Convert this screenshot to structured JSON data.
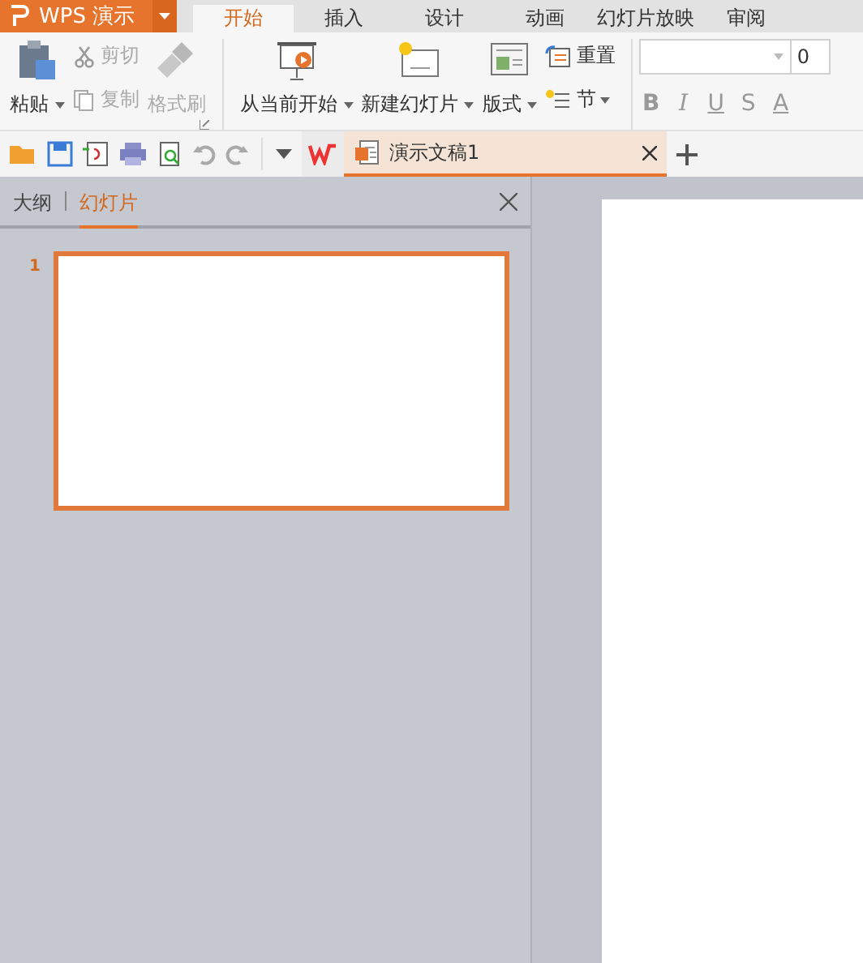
{
  "app_menu": {
    "label": "WPS 演示"
  },
  "tabs": [
    {
      "label": "开始",
      "selected": true
    },
    {
      "label": "插入",
      "selected": false
    },
    {
      "label": "设计",
      "selected": false
    },
    {
      "label": "动画",
      "selected": false
    },
    {
      "label": "幻灯片放映",
      "selected": false
    },
    {
      "label": "审阅",
      "selected": false
    }
  ],
  "clipboard": {
    "paste": "粘贴",
    "cut": {
      "label": "剪切",
      "disabled": true
    },
    "copy": {
      "label": "复制",
      "disabled": true
    },
    "format_painter": {
      "label": "格式刷",
      "disabled": true
    }
  },
  "slides_group": {
    "start": "从当前开始",
    "new_slide": "新建幻灯片",
    "layout": "版式",
    "reset": "重置",
    "section": "节"
  },
  "font": {
    "size": "0",
    "styles": [
      "B",
      "I",
      "U",
      "S",
      "A"
    ]
  },
  "document_tab": {
    "title": "演示文稿1"
  },
  "panel_tabs": [
    {
      "label": "大纲",
      "selected": false
    },
    {
      "label": "幻灯片",
      "selected": true
    }
  ],
  "slides": [
    {
      "number": "1",
      "selected": true
    }
  ]
}
